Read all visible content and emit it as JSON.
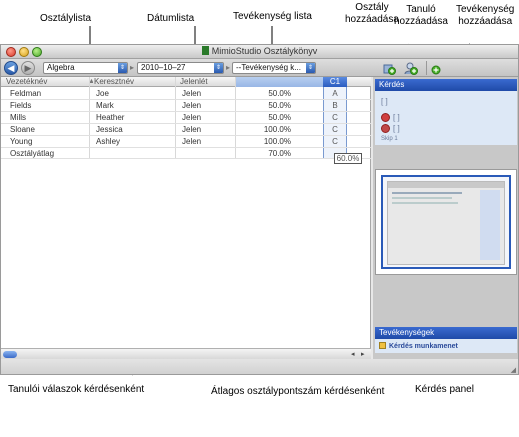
{
  "callouts": {
    "class_list": "Osztálylista",
    "date_list": "Dátumlista",
    "activity_list": "Tevékenység lista",
    "add_class": "Osztály\nhozzáadása",
    "add_student": "Tanuló\nhozzáadása",
    "add_activity": "Tevékenység\nhozzáadása",
    "student_answers": "Tanulói válaszok kérdésenként",
    "avg_score": "Átlagos osztálypontszám kérdésenként",
    "question_panel": "Kérdés panel"
  },
  "window": {
    "title": "MimioStudio Osztálykönyv"
  },
  "toolbar": {
    "class_select": "Algebra",
    "date_select": "2010–10–27",
    "activity_select": "--Tevékenység k..."
  },
  "grid": {
    "headers": {
      "last_name": "Vezetéknév",
      "first_name": "Keresztnév",
      "presence": "Jelenlét",
      "question": "C1"
    },
    "rows": [
      {
        "last": "Feldman",
        "first": "Joe",
        "presence": "Jelen",
        "score": "50.0%",
        "answer": "A"
      },
      {
        "last": "Fields",
        "first": "Mark",
        "presence": "Jelen",
        "score": "50.0%",
        "answer": "B"
      },
      {
        "last": "Mills",
        "first": "Heather",
        "presence": "Jelen",
        "score": "50.0%",
        "answer": "C"
      },
      {
        "last": "Sloane",
        "first": "Jessica",
        "presence": "Jelen",
        "score": "100.0%",
        "answer": "C"
      },
      {
        "last": "Young",
        "first": "Ashley",
        "presence": "Jelen",
        "score": "100.0%",
        "answer": "C"
      }
    ],
    "average": {
      "label": "Osztályátlag",
      "score": "70.0%",
      "question_avg": "60.0%"
    }
  },
  "panel": {
    "question_title": "Kérdés",
    "question_line": "[ ]",
    "question_option": "[ ]",
    "question_footer": "Skip 1",
    "activities_title": "Tevékenységek",
    "activity_item": "Kérdés munkamenet"
  },
  "colors": {
    "accent": "#2a5cc0",
    "panel_bg": "#c8c8c8"
  }
}
